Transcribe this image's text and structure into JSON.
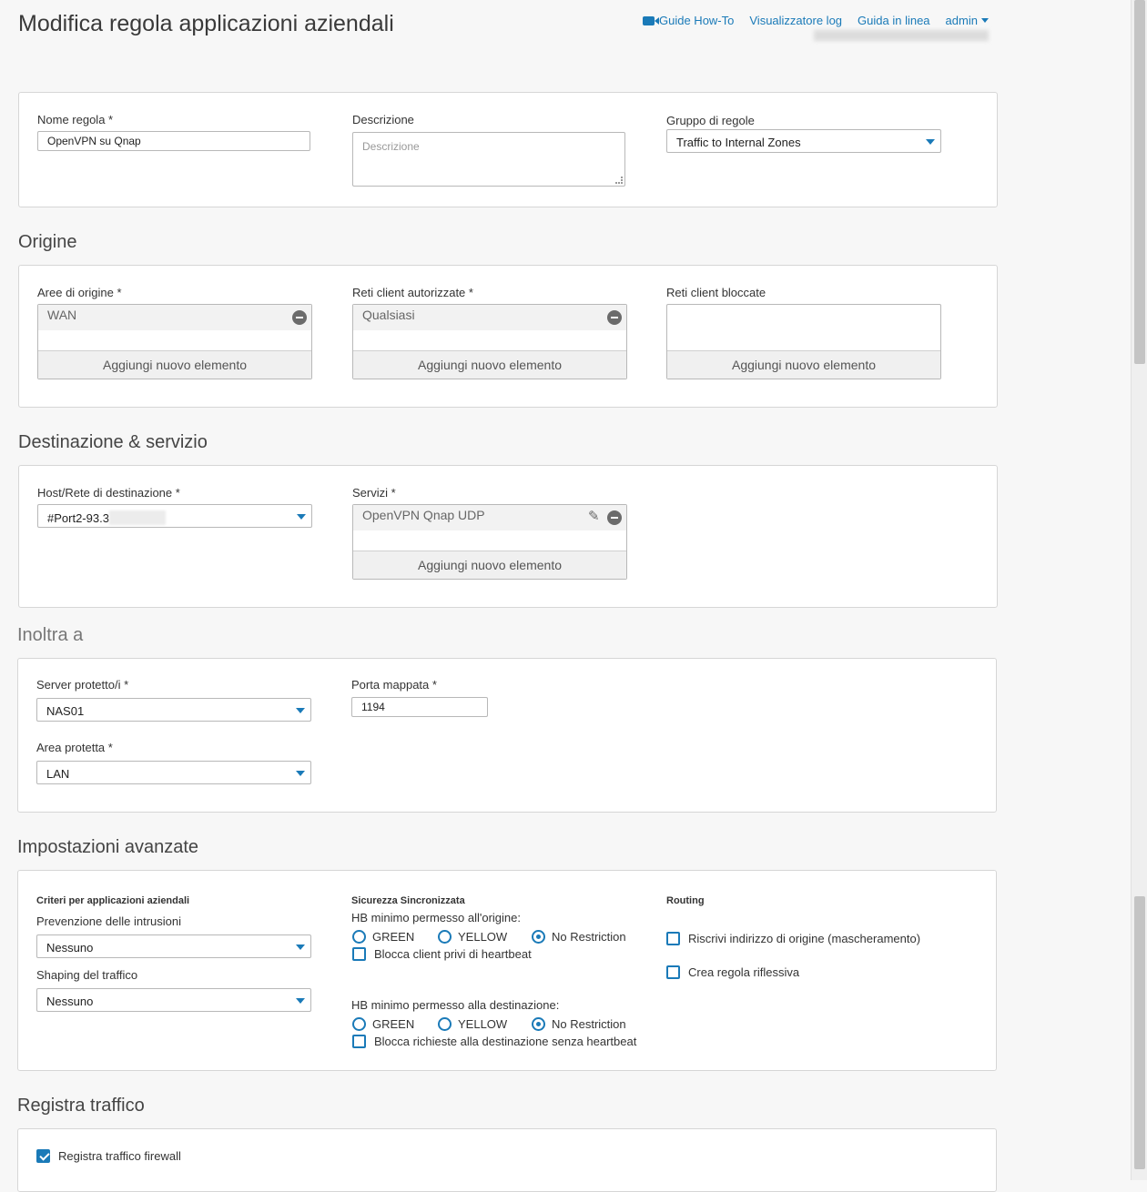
{
  "page": {
    "title": "Modifica regola applicazioni aziendali"
  },
  "topbar": {
    "guide_howto": "Guide How-To",
    "log_viewer": "Visualizzatore log",
    "online_help": "Guida in linea",
    "admin": "admin"
  },
  "rule": {
    "name_label": "Nome regola *",
    "name_value": "OpenVPN su Qnap",
    "description_label": "Descrizione",
    "description_placeholder": "Descrizione",
    "group_label": "Gruppo di regole",
    "group_value": "Traffic to Internal Zones"
  },
  "origin": {
    "title": "Origine",
    "zones_label": "Aree di origine *",
    "zones_items": [
      "WAN"
    ],
    "allowed_label": "Reti client autorizzate *",
    "allowed_items": [
      "Qualsiasi"
    ],
    "blocked_label": "Reti client bloccate",
    "add_label": "Aggiungi nuovo elemento"
  },
  "destination": {
    "title": "Destinazione & servizio",
    "host_label": "Host/Rete di destinazione *",
    "host_value": "#Port2-93.3",
    "services_label": "Servizi *",
    "services_items": [
      "OpenVPN Qnap UDP"
    ],
    "add_label": "Aggiungi nuovo elemento"
  },
  "forward": {
    "title": "Inoltra a",
    "server_label": "Server protetto/i *",
    "server_value": "NAS01",
    "port_label": "Porta mappata *",
    "port_value": "1194",
    "zone_label": "Area protetta *",
    "zone_value": "LAN"
  },
  "advanced": {
    "title": "Impostazioni avanzate",
    "criteria_title": "Criteri per applicazioni aziendali",
    "ips_label": "Prevenzione delle intrusioni",
    "ips_value": "Nessuno",
    "shaping_label": "Shaping del traffico",
    "shaping_value": "Nessuno",
    "sync_title": "Sicurezza Sincronizzata",
    "hb_source_label": "HB minimo permesso all'origine:",
    "hb_dest_label": "HB minimo permesso alla destinazione:",
    "opt_green": "GREEN",
    "opt_yellow": "YELLOW",
    "opt_norestrict": "No Restriction",
    "block_no_hb_client": "Blocca client privi di heartbeat",
    "block_no_hb_dest": "Blocca richieste alla destinazione senza heartbeat",
    "routing_title": "Routing",
    "masquerade_label": "Riscrivi indirizzo di origine (mascheramento)",
    "reflexive_label": "Crea regola riflessiva"
  },
  "logging": {
    "title": "Registra traffico",
    "firewall_log_label": "Registra traffico firewall"
  }
}
